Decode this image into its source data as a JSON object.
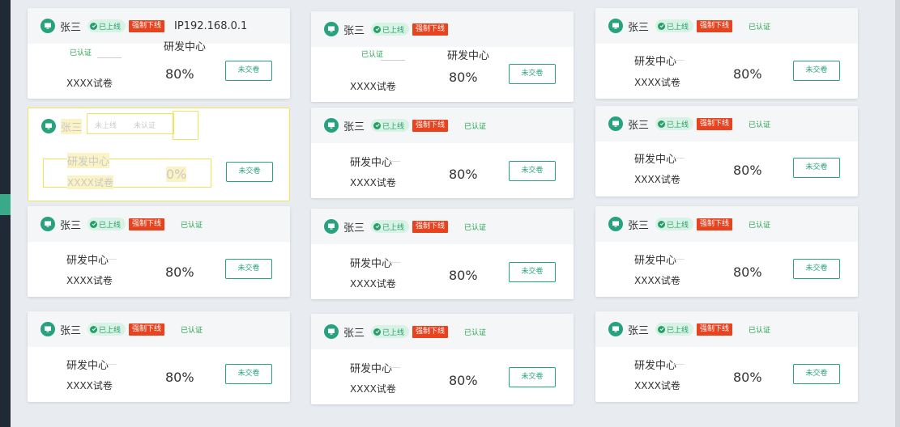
{
  "colors": {
    "accent": "#27a27d",
    "online": "#26a069",
    "offline": "#e8431f",
    "verified": "#1fa347"
  },
  "cards": [
    {
      "name": "张三",
      "status": "已上线",
      "force_offline": "强制下线",
      "ip": "IP192.168.0.1",
      "verified": "已认证",
      "dept": "研发中心",
      "paper": "XXXX试卷",
      "percent": "80%",
      "action": "未交卷"
    },
    {
      "name": "张三",
      "status": "已上线",
      "force_offline": "强制下线",
      "verified": "已认证",
      "dept": "研发中心",
      "paper": "XXXX试卷",
      "percent": "80%",
      "action": "未交卷"
    },
    {
      "name": "张三",
      "status": "已上线",
      "force_offline": "强制下线",
      "verified": "已认证",
      "dept": "研发中心",
      "paper": "XXXX试卷",
      "percent": "80%",
      "action": "未交卷"
    },
    {
      "name": "张三",
      "status": "未上线",
      "verified": "未认证",
      "dept": "研发中心",
      "paper": "XXXX试卷",
      "percent": "0%",
      "action": "未交卷"
    },
    {
      "name": "张三",
      "status": "已上线",
      "force_offline": "强制下线",
      "verified": "已认证",
      "dept": "研发中心",
      "paper": "XXXX试卷",
      "percent": "80%",
      "action": "未交卷"
    },
    {
      "name": "张三",
      "status": "已上线",
      "force_offline": "强制下线",
      "verified": "已认证",
      "dept": "研发中心",
      "paper": "XXXX试卷",
      "percent": "80%",
      "action": "未交卷"
    },
    {
      "name": "张三",
      "status": "已上线",
      "force_offline": "强制下线",
      "verified": "已认证",
      "dept": "研发中心",
      "paper": "XXXX试卷",
      "percent": "80%",
      "action": "未交卷"
    },
    {
      "name": "张三",
      "status": "已上线",
      "force_offline": "强制下线",
      "verified": "已认证",
      "dept": "研发中心",
      "paper": "XXXX试卷",
      "percent": "80%",
      "action": "未交卷"
    },
    {
      "name": "张三",
      "status": "已上线",
      "force_offline": "强制下线",
      "verified": "已认证",
      "dept": "研发中心",
      "paper": "XXXX试卷",
      "percent": "80%",
      "action": "未交卷"
    },
    {
      "name": "张三",
      "status": "已上线",
      "force_offline": "强制下线",
      "verified": "已认证",
      "dept": "研发中心",
      "paper": "XXXX试卷",
      "percent": "80%",
      "action": "未交卷"
    },
    {
      "name": "张三",
      "status": "已上线",
      "force_offline": "强制下线",
      "verified": "已认证",
      "dept": "研发中心",
      "paper": "XXXX试卷",
      "percent": "80%",
      "action": "未交卷"
    },
    {
      "name": "张三",
      "status": "已上线",
      "force_offline": "强制下线",
      "verified": "已认证",
      "dept": "研发中心",
      "paper": "XXXX试卷",
      "percent": "80%",
      "action": "未交卷"
    }
  ]
}
